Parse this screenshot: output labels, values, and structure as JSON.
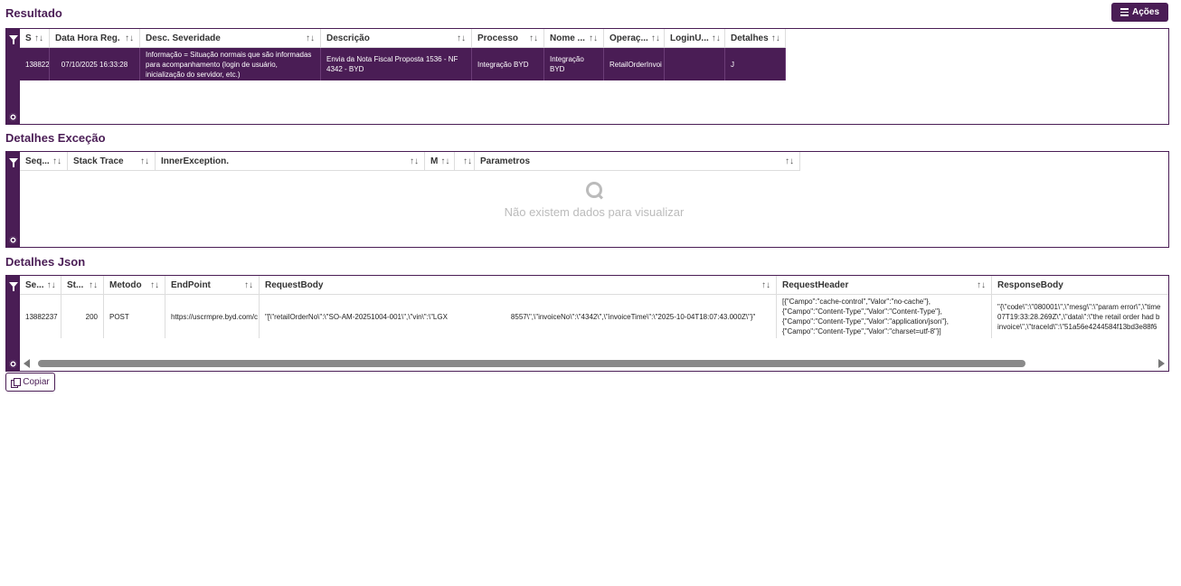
{
  "resultado": {
    "title": "Resultado",
    "actions_label": "Ações",
    "columns": [
      "S",
      "Data Hora Reg.",
      "Desc. Severidade",
      "Descrição",
      "Processo",
      "Nome ...",
      "Operaç...",
      "LoginU...",
      "Detalhes"
    ],
    "row": {
      "s": "138822",
      "data_hora": "07/10/2025 16:33:28",
      "severidade": "Informação = Situação normais que são informadas para acompanhamento (login de usuário, inicialização do servidor, etc.)",
      "descricao": "Envia da Nota Fiscal Proposta 1536 - NF 4342 - BYD",
      "processo": "Integração BYD",
      "nome": "Integração BYD",
      "operacao": "RetailOrderInvoi",
      "login": "",
      "detalhes": "J"
    }
  },
  "excecao": {
    "title": "Detalhes Exceção",
    "columns": [
      "Seq...",
      "Stack Trace",
      "InnerException.",
      "M",
      "",
      "Parametros"
    ],
    "empty_message": "Não existem dados para visualizar"
  },
  "json": {
    "title": "Detalhes Json",
    "columns": [
      "Se...",
      "St...",
      "Metodo",
      "EndPoint",
      "RequestBody",
      "RequestHeader",
      "ResponseBody"
    ],
    "row": {
      "seq": "13882237",
      "status": "200",
      "metodo": "POST",
      "endpoint": "https://uscrmpre.byd.com/c",
      "request_body_a": "\"[\\\"retailOrderNo\\\":\\\"SO-AM-20251004-001\\\",\\\"vin\\\":\\\"LGX",
      "request_body_b": "8557\\\",\\\"invoiceNo\\\":\\\"4342\\\",\\\"invoiceTime\\\":\\\"2025-10-04T18:07:43.000Z\\\"}\"",
      "request_header": [
        "[{\"Campo\":\"cache-control\",\"Valor\":\"no-cache\"},",
        "{\"Campo\":\"Content-Type\",\"Valor\":\"Content-Type\"},",
        "{\"Campo\":\"Content-Type\",\"Valor\":\"application/json\"},",
        "{\"Campo\":\"Content-Type\",\"Valor\":\"charset=utf-8\"}]"
      ],
      "response_body": [
        "\"{\\\"code\\\":\\\"080001\\\",\\\"mesg\\\":\\\"param error\\\",\\\"time",
        "07T19:33:28.269Z\\\",\\\"data\\\":\\\"the retail order had b",
        "invoice\\\",\\\"traceId\\\":\\\"51a56e4244584f13bd3e88f6"
      ]
    },
    "copy_label": "Copiar"
  }
}
